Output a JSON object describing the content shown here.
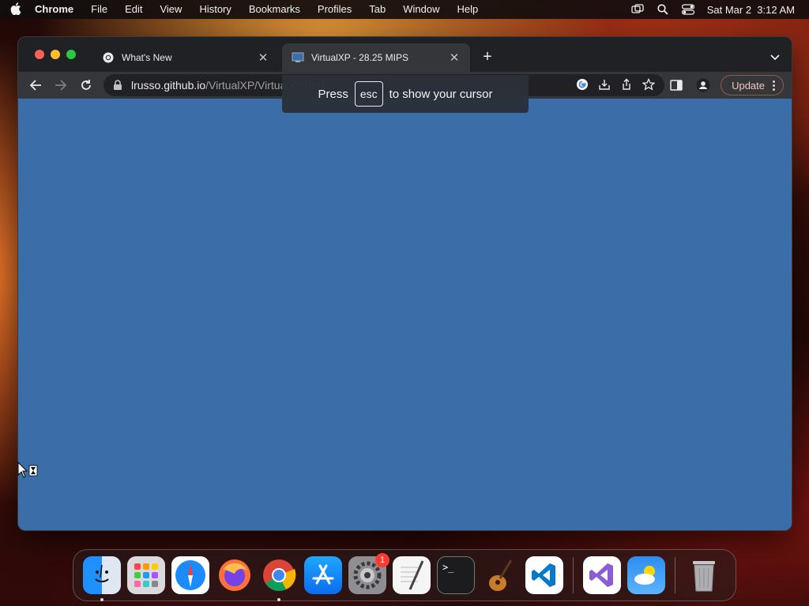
{
  "menubar": {
    "app_name": "Chrome",
    "items": [
      "File",
      "Edit",
      "View",
      "History",
      "Bookmarks",
      "Profiles",
      "Tab",
      "Window",
      "Help"
    ],
    "clock": "Sat Mar 2  3:12 AM"
  },
  "browser": {
    "tabs": [
      {
        "title": "What's New",
        "active": false
      },
      {
        "title": "VirtualXP - 28.25 MIPS",
        "active": true
      }
    ],
    "url_host": "lrusso.github.io",
    "url_path": "/VirtualXP/VirtualXP.htm",
    "update_label": "Update"
  },
  "fullscreen_notice": {
    "before": "Press",
    "key": "esc",
    "after": "to show your cursor"
  },
  "page": {
    "background_color": "#3b6ea8"
  },
  "dock": {
    "apps": [
      {
        "name": "finder-icon",
        "running": true
      },
      {
        "name": "launchpad-icon",
        "running": false
      },
      {
        "name": "safari-icon",
        "running": false
      },
      {
        "name": "firefox-icon",
        "running": false
      },
      {
        "name": "chrome-icon",
        "running": true
      },
      {
        "name": "app-store-icon",
        "running": false
      },
      {
        "name": "system-settings-icon",
        "running": false,
        "badge": "1"
      },
      {
        "name": "textedit-icon",
        "running": false
      },
      {
        "name": "terminal-icon",
        "running": false
      },
      {
        "name": "garageband-icon",
        "running": false
      },
      {
        "name": "vscode-icon",
        "running": false
      },
      {
        "name": "visual-studio-icon",
        "running": false
      },
      {
        "name": "weather-icon",
        "running": false
      },
      {
        "name": "trash-icon",
        "running": false
      }
    ]
  }
}
